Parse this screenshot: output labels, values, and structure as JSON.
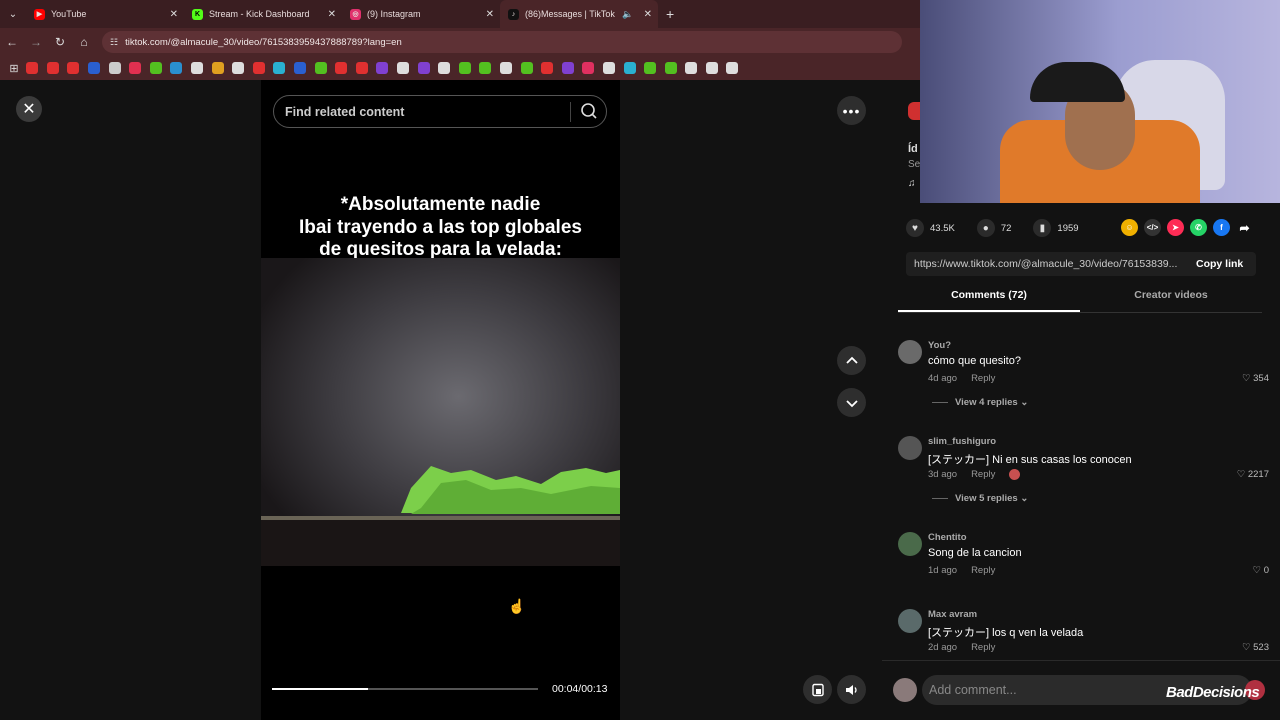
{
  "browser": {
    "tabs": [
      {
        "title": "YouTube",
        "fav_color": "#ff0000",
        "fav_glyph": "▶"
      },
      {
        "title": "Stream - Kick Dashboard",
        "fav_color": "#53fc18",
        "fav_glyph": "K"
      },
      {
        "title": "(9) Instagram",
        "fav_color": "#e1306c",
        "fav_glyph": "◎"
      },
      {
        "title": "(86)Messages | TikTok",
        "fav_color": "#000000",
        "fav_glyph": "♪",
        "active": true
      }
    ],
    "close_glyph": "✕",
    "new_tab_glyph": "+",
    "url": "tiktok.com/@almacule_30/video/7615383959437888789?lang=en",
    "bookmark_colors": [
      "#e03030",
      "#e03030",
      "#e03030",
      "#2a5fd0",
      "#cccccc",
      "#e03050",
      "#53c020",
      "#2a8fd0",
      "#dddddd",
      "#e0a020",
      "#dddddd",
      "#e03030",
      "#2ab0d0",
      "#2a5fd0",
      "#53c020",
      "#e03030",
      "#e03030",
      "#8040d0",
      "#dddddd",
      "#8040d0",
      "#dddddd",
      "#53c020",
      "#53c020",
      "#dddddd",
      "#53c020",
      "#e03030",
      "#8040d0",
      "#e03060",
      "#dddddd",
      "#2ab0d0",
      "#53c020",
      "#53c020",
      "#dddddd",
      "#dddddd",
      "#dddddd"
    ]
  },
  "video": {
    "search_placeholder": "Find related content",
    "caption_lines": [
      "*Absolutamente nadie",
      "Ibai trayendo a las top globales",
      "de quesitos para la velada:"
    ],
    "progress": 0.36,
    "time": "00:04/00:13"
  },
  "side": {
    "partial_lines": [
      "Íd",
      "Se",
      "♫"
    ],
    "likes": "43.5K",
    "comments_count": "72",
    "saves": "1959",
    "share_colors": [
      "#f0b000",
      "#333333",
      "#fe2c55",
      "#25d366",
      "#1877f2"
    ],
    "link": "https://www.tiktok.com/@almacule_30/video/76153839...",
    "copy_label": "Copy link",
    "tab_comments": "Comments (72)",
    "tab_creator": "Creator videos"
  },
  "comments": [
    {
      "name": "You?",
      "text": "cómo que quesito?",
      "time": "4d ago",
      "reply": "Reply",
      "likes": "354",
      "replies": "View 4 replies"
    },
    {
      "name": "slim_fushiguro",
      "text": "[ステッカー] Ni en sus casas los conocen",
      "time": "3d ago",
      "reply": "Reply",
      "likes": "2217",
      "replies": "View 5 replies"
    },
    {
      "name": "Chentito",
      "text": "Song de la cancion",
      "time": "1d ago",
      "reply": "Reply",
      "likes": "0",
      "replies": ""
    },
    {
      "name": "Max avram",
      "text": "[ステッカー] los q ven la velada",
      "time": "2d ago",
      "reply": "Reply",
      "likes": "523",
      "replies": ""
    }
  ],
  "add_comment_placeholder": "Add comment...",
  "watermark": "BadDecisions"
}
